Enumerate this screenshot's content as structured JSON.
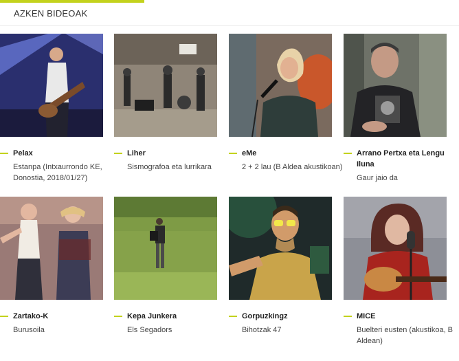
{
  "section": {
    "title": "AZKEN BIDEOAK"
  },
  "colors": {
    "accent": "#c3d21c"
  },
  "videos": [
    {
      "artist": "Pelax",
      "subtitle": "Estanpa (Intxaurrondo KE, Donostia, 2018/01/27)"
    },
    {
      "artist": "Liher",
      "subtitle": "Sismografoa eta lurrikara"
    },
    {
      "artist": "eMe",
      "subtitle": "2 + 2 lau (B Aldea akustikoan)"
    },
    {
      "artist": "Arrano Pertxa eta Lengu Iluna",
      "subtitle": "Gaur jaio da"
    },
    {
      "artist": "Zartako-K",
      "subtitle": "Burusoila"
    },
    {
      "artist": "Kepa Junkera",
      "subtitle": "Els Segadors"
    },
    {
      "artist": "Gorpuzkingz",
      "subtitle": "Bihotzak 47"
    },
    {
      "artist": "MICE",
      "subtitle": "Buelteri eusten (akustikoa, B Aldean)"
    }
  ]
}
